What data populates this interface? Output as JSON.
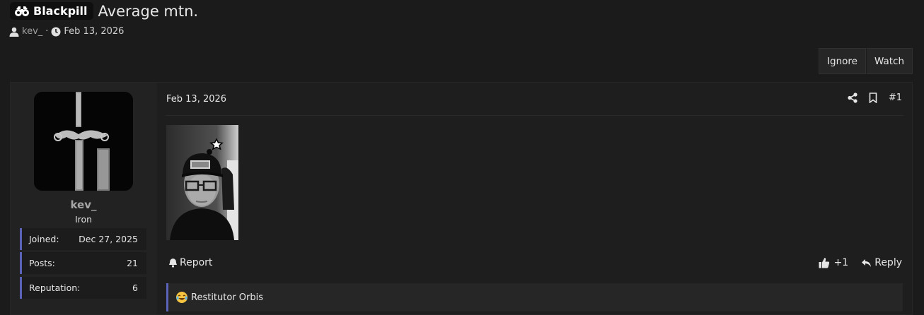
{
  "thread": {
    "prefix": "Blackpill",
    "title": "Average mtn.",
    "author": "kev_",
    "separator": "·",
    "date": "Feb 13, 2026"
  },
  "actions": {
    "ignore": "Ignore",
    "watch": "Watch"
  },
  "user": {
    "name": "kev_",
    "rank": "Iron",
    "stats": [
      {
        "label": "Joined:",
        "value": "Dec 27, 2025"
      },
      {
        "label": "Posts:",
        "value": "21"
      },
      {
        "label": "Reputation:",
        "value": "6"
      }
    ]
  },
  "post": {
    "date": "Feb 13, 2026",
    "number": "#1",
    "report": "Report",
    "reaction": "+1",
    "reply": "Reply"
  },
  "signature": {
    "text": "Restitutor Orbis"
  },
  "colors": {
    "accent": "#5a63b8",
    "background": "#1b1b1b"
  }
}
